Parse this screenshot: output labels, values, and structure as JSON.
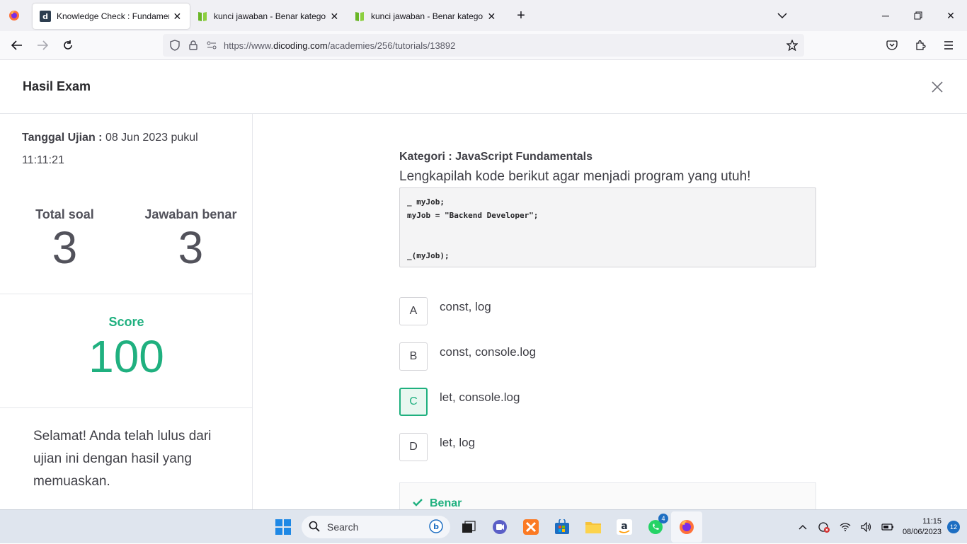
{
  "browser": {
    "tabs": [
      {
        "title": "Knowledge Check : Fundamentals",
        "favicon": "dicoding-logo",
        "active": true
      },
      {
        "title": "kunci jawaban - Benar kategori",
        "favicon": "green-book-icon",
        "active": false
      },
      {
        "title": "kunci jawaban - Benar kategori",
        "favicon": "green-book-icon",
        "active": false
      }
    ],
    "url": {
      "prefix": "https://www.",
      "host": "dicoding.com",
      "path": "/academies/256/tutorials/13892"
    }
  },
  "page": {
    "title": "Hasil Exam",
    "exam_date_label": "Tanggal Ujian :",
    "exam_date_value": "08 Jun 2023 pukul 11:11:21",
    "total_label": "Total soal",
    "total_value": "3",
    "correct_label": "Jawaban benar",
    "correct_value": "3",
    "score_label": "Score",
    "score_value": "100",
    "congrats": "Selamat! Anda telah lulus dari ujian ini dengan hasil yang memuaskan."
  },
  "question": {
    "kategori": "Kategori : JavaScript Fundamentals",
    "text": "Lengkapilah kode berikut agar menjadi program yang utuh!",
    "code": "_ myJob;\nmyJob = \"Backend Developer\";\n\n\n_(myJob);",
    "options": [
      {
        "letter": "A",
        "text": "const, log",
        "selected": false
      },
      {
        "letter": "B",
        "text": "const, console.log",
        "selected": false
      },
      {
        "letter": "C",
        "text": "let, console.log",
        "selected": true
      },
      {
        "letter": "D",
        "text": "let, log",
        "selected": false
      }
    ],
    "result": "Benar"
  },
  "taskbar": {
    "search_label": "Search",
    "whatsapp_badge": "4",
    "time": "11:15",
    "date": "08/06/2023",
    "notifications": "12"
  },
  "colors": {
    "accent": "#1fb07f",
    "text": "#3f3f46"
  }
}
